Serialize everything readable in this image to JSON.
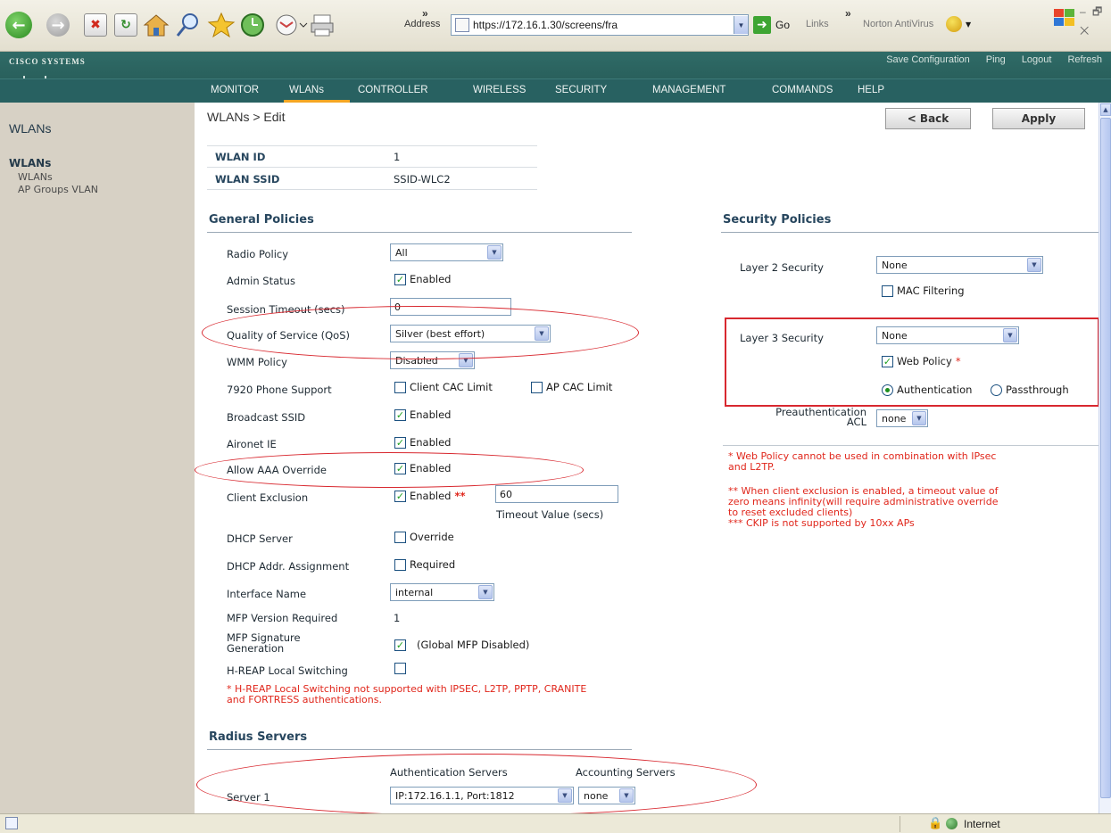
{
  "browser": {
    "more_chevron": "»",
    "address_label": "Address",
    "address_url": "https://172.16.1.30/screens/fra",
    "go_label": "Go",
    "links_label": "Links",
    "more_chevron2": "»",
    "norton_label": "Norton AntiVirus",
    "window_controls": "– 🗗 ✕"
  },
  "cisco": {
    "logo_text": "CISCO SYSTEMS",
    "header_links": [
      "Save Configuration",
      "Ping",
      "Logout",
      "Refresh"
    ],
    "nav": [
      "MONITOR",
      "WLANs",
      "CONTROLLER",
      "WIRELESS",
      "SECURITY",
      "MANAGEMENT",
      "COMMANDS",
      "HELP"
    ],
    "active_nav": "WLANs"
  },
  "sidebar": {
    "title": "WLANs",
    "group": "WLANs",
    "items": [
      "WLANs",
      "AP Groups VLAN"
    ]
  },
  "page": {
    "breadcrumb": "WLANs > Edit",
    "back_button": "< Back",
    "apply_button": "Apply",
    "wlan_id_label": "WLAN ID",
    "wlan_id_value": "1",
    "wlan_ssid_label": "WLAN SSID",
    "wlan_ssid_value": "SSID-WLC2"
  },
  "general": {
    "title": "General Policies",
    "radio_policy_label": "Radio Policy",
    "radio_policy_value": "All",
    "admin_status_label": "Admin Status",
    "enabled_text": "Enabled",
    "session_timeout_label": "Session Timeout (secs)",
    "session_timeout_value": "0",
    "qos_label": "Quality of Service (QoS)",
    "qos_value": "Silver (best effort)",
    "wmm_label": "WMM Policy",
    "wmm_value": "Disabled",
    "phone_label": "7920 Phone Support",
    "client_cac": "Client CAC Limit",
    "ap_cac": "AP CAC Limit",
    "broadcast_label": "Broadcast SSID",
    "aironet_label": "Aironet IE",
    "aaa_label": "Allow AAA Override",
    "exclusion_label": "Client Exclusion",
    "exclusion_marker": "**",
    "exclusion_timeout": "60",
    "timeout_caption": "Timeout Value (secs)",
    "dhcp_label": "DHCP Server",
    "override_text": "Override",
    "dhcp_addr_label": "DHCP Addr. Assignment",
    "required_text": "Required",
    "interface_label": "Interface Name",
    "interface_value": "internal",
    "mfp_version_label": "MFP Version Required",
    "mfp_version_value": "1",
    "mfp_sig_label_1": "MFP Signature",
    "mfp_sig_label_2": "Generation",
    "mfp_global": "(Global MFP Disabled)",
    "hreap_label": "H-REAP Local Switching",
    "hreap_note_1": "* H-REAP Local Switching not supported with IPSEC, L2TP, PPTP, CRANITE",
    "hreap_note_2": "and FORTRESS authentications."
  },
  "security": {
    "title": "Security Policies",
    "l2_label": "Layer 2 Security",
    "l2_value": "None",
    "mac_filter": "MAC Filtering",
    "l3_label": "Layer 3 Security",
    "l3_value": "None",
    "web_policy": "Web Policy",
    "web_policy_marker": "*",
    "auth_radio": "Authentication",
    "pass_radio": "Passthrough",
    "preauth_label_1": "Preauthentication",
    "preauth_label_2": "ACL",
    "preauth_value": "none",
    "note_1a": "* Web Policy cannot be used in combination with IPsec",
    "note_1b": "and L2TP.",
    "note_2a": "** When client exclusion is enabled, a timeout value of",
    "note_2b": "zero means infinity(will require administrative override",
    "note_2c": "to reset excluded clients)",
    "note_3": "*** CKIP is not supported by 10xx APs"
  },
  "radius": {
    "title": "Radius Servers",
    "auth_header": "Authentication Servers",
    "acct_header": "Accounting Servers",
    "server1_label": "Server 1",
    "server1_auth": "IP:172.16.1.1, Port:1812",
    "server1_acct": "none"
  },
  "statusbar": {
    "zone": "Internet"
  },
  "colors": {
    "header_teal": "#286161",
    "nav_accent": "#f5a623",
    "annotation_red": "#d8282f",
    "sidebar_bg": "#d7d1c5"
  }
}
